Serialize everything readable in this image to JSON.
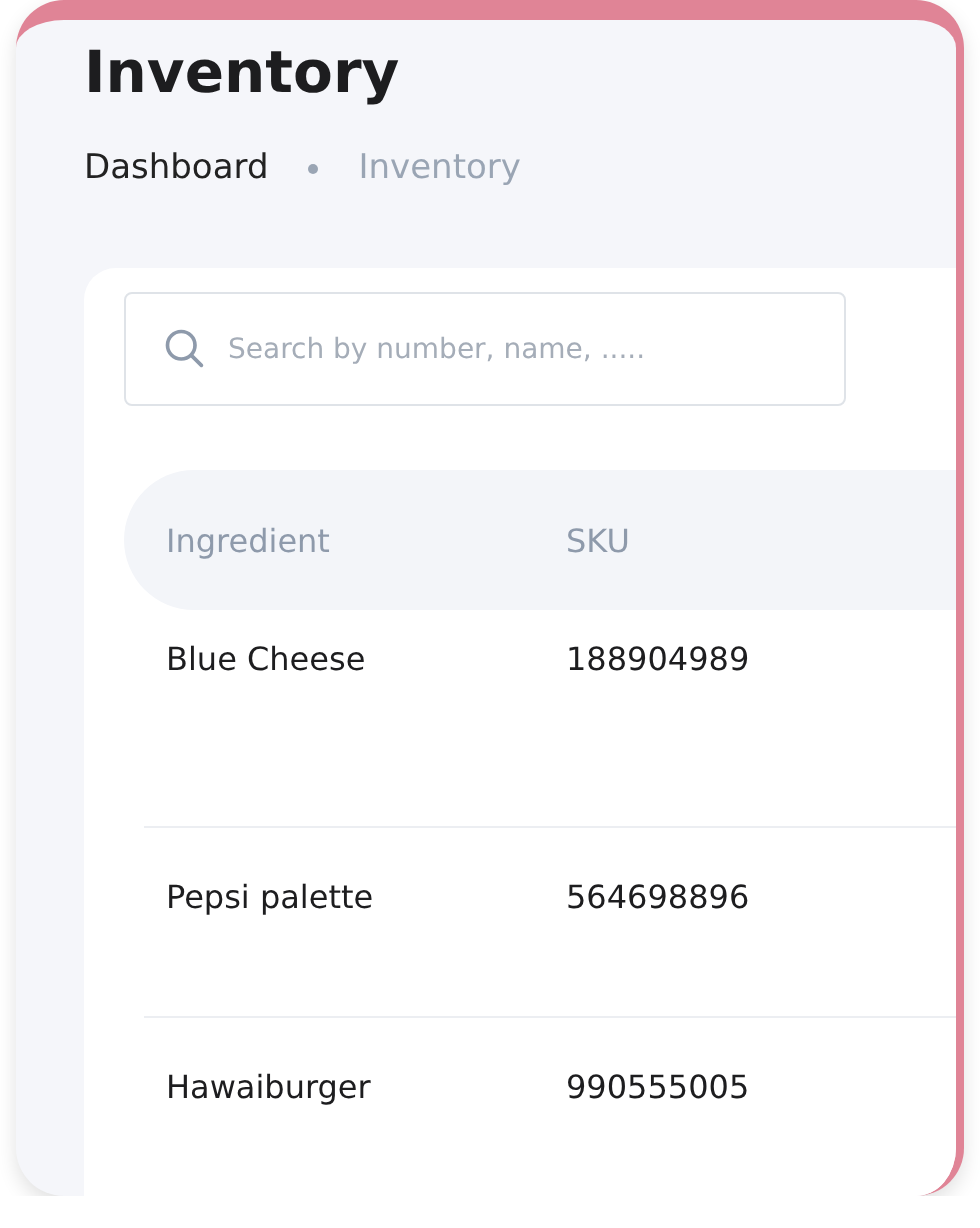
{
  "page": {
    "title": "Inventory"
  },
  "breadcrumbs": [
    {
      "label": "Dashboard",
      "selected": false
    },
    {
      "label": "Inventory",
      "selected": true
    }
  ],
  "search": {
    "placeholder": "Search by number, name, ....."
  },
  "table": {
    "columns": [
      "Ingredient",
      "SKU"
    ],
    "rows": [
      [
        "Blue Cheese",
        "188904989"
      ],
      [
        "Pepsi palette",
        "564698896"
      ],
      [
        "Hawaiburger",
        "990555005"
      ]
    ]
  }
}
